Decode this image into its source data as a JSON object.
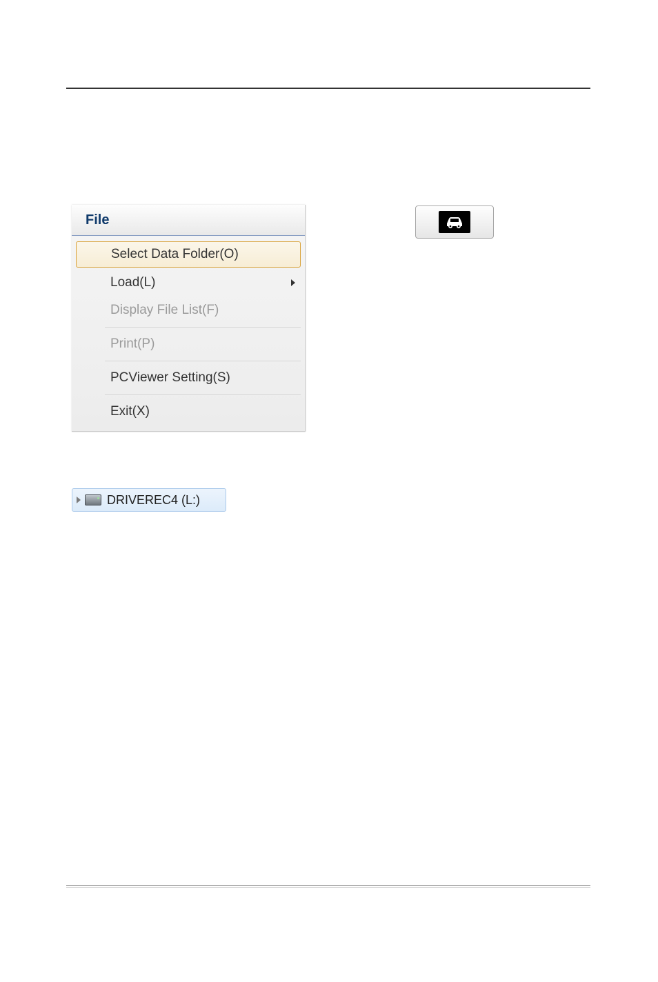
{
  "menu": {
    "header": "File",
    "items": [
      {
        "label": "Select Data Folder(O)",
        "state": "highlight",
        "enabled": true,
        "hasSubmenu": false
      },
      {
        "label": "Load(L)",
        "state": "normal",
        "enabled": true,
        "hasSubmenu": true
      },
      {
        "label": "Display File List(F)",
        "state": "normal",
        "enabled": false,
        "hasSubmenu": false
      },
      {
        "label": "Print(P)",
        "state": "normal",
        "enabled": false,
        "hasSubmenu": false
      },
      {
        "label": "PCViewer Setting(S)",
        "state": "normal",
        "enabled": true,
        "hasSubmenu": false
      },
      {
        "label": "Exit(X)",
        "state": "normal",
        "enabled": true,
        "hasSubmenu": false
      }
    ]
  },
  "toolbar": {
    "open_folder_button_icon": "car-icon"
  },
  "tree": {
    "drive_label": "DRIVEREC4 (L:)"
  },
  "colors": {
    "highlight_border": "#d9a23a",
    "tree_selection_bg_top": "#ecf4fc",
    "tree_selection_bg_bottom": "#dcebfa",
    "menu_title": "#103a6b"
  }
}
